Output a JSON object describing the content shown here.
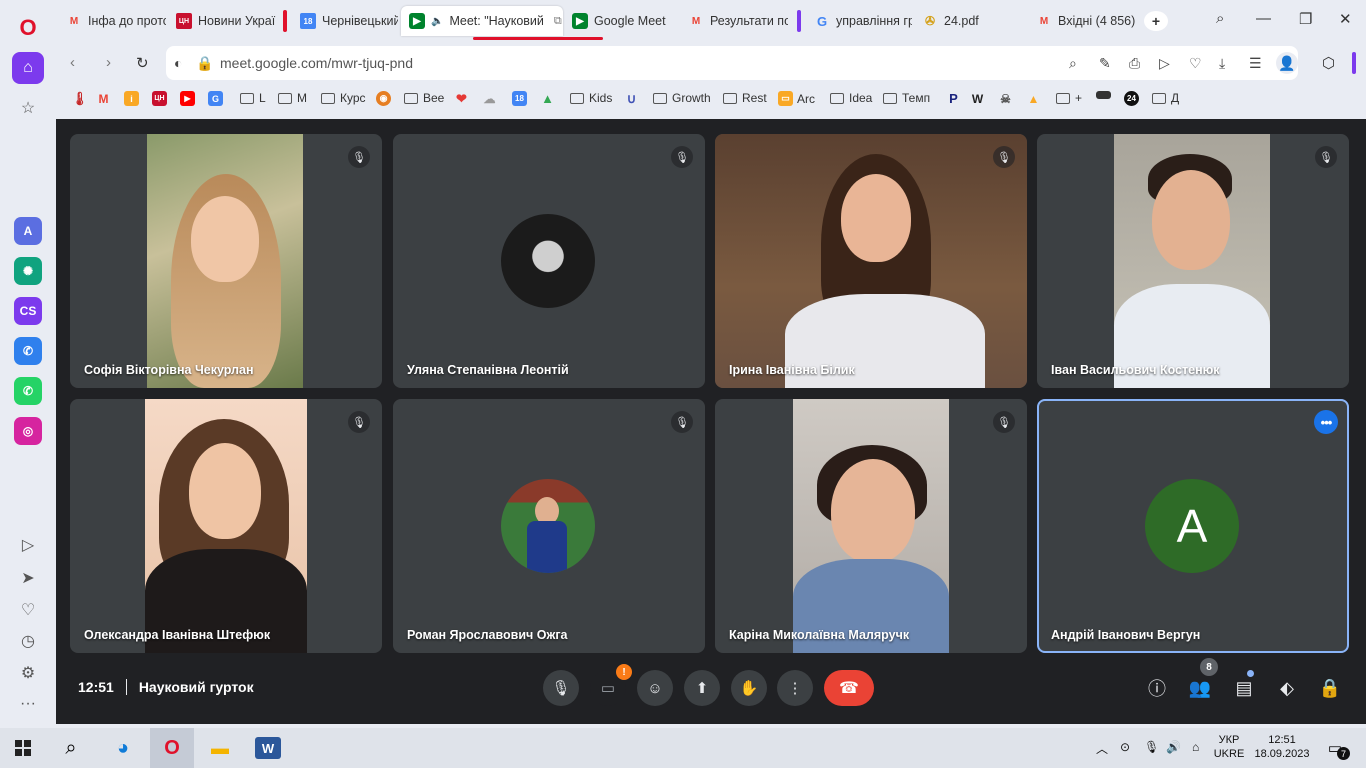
{
  "browser": {
    "tabs": [
      {
        "title": "Інфа до прото",
        "icon": "gmail-icon"
      },
      {
        "title": "Новини Украї",
        "icon": "news-icon"
      },
      {
        "title": "Чернівецький",
        "icon": "calendar-icon"
      },
      {
        "title": "Meet: \"Науковий",
        "icon": "meet-icon",
        "active": true
      },
      {
        "title": "Google Meet",
        "icon": "meet-icon"
      },
      {
        "title": "Результати по",
        "icon": "gmail-icon"
      },
      {
        "title": "управління гр",
        "icon": "google-icon"
      },
      {
        "title": "24.pdf",
        "icon": "pdf-icon"
      },
      {
        "title": "Вхідні (4 856)",
        "icon": "gmail-icon"
      }
    ],
    "new_tab_label": "+",
    "url_host": "meet.google.com",
    "url_path": "/mwr-tjuq-pnd",
    "bookmarks": [
      {
        "label": "L",
        "type": "folder"
      },
      {
        "label": "M",
        "type": "folder"
      },
      {
        "label": "Курс",
        "type": "folder"
      },
      {
        "label": "Bee",
        "type": "folder"
      },
      {
        "label": "Kids",
        "type": "folder"
      },
      {
        "label": "Growth",
        "type": "folder"
      },
      {
        "label": "Rest",
        "type": "folder"
      },
      {
        "label": "Arc",
        "type": "site"
      },
      {
        "label": "Idea",
        "type": "folder"
      },
      {
        "label": "Темп",
        "type": "folder"
      },
      {
        "label": "+",
        "type": "folder"
      },
      {
        "label": "Д",
        "type": "folder"
      }
    ]
  },
  "meet": {
    "time": "12:51",
    "meeting_title": "Науковий гурток",
    "people_count": "8",
    "participants": [
      {
        "name": "Софія Вікторівна Чекурлан"
      },
      {
        "name": "Уляна Степанівна Леонтій"
      },
      {
        "name": "Ірина Іванівна Білик"
      },
      {
        "name": "Іван Васильович Костенюк"
      },
      {
        "name": "Олександра Іванівна Штефюк"
      },
      {
        "name": "Роман Ярославович Ожга"
      },
      {
        "name": "Каріна Миколаївна Маляручк"
      },
      {
        "name": "Андрій Іванович Вергун",
        "avatar_letter": "A",
        "avatar_color": "#2e6b27"
      }
    ],
    "camera_warning_badge": "!",
    "colors": {
      "end_call": "#ea4335",
      "accent": "#1a73e8",
      "tile": "#3c4043",
      "background": "#202124"
    }
  },
  "taskbar": {
    "language": "УКР",
    "layout": "UKRE",
    "time": "12:51",
    "date": "18.09.2023",
    "notifications": "7"
  }
}
